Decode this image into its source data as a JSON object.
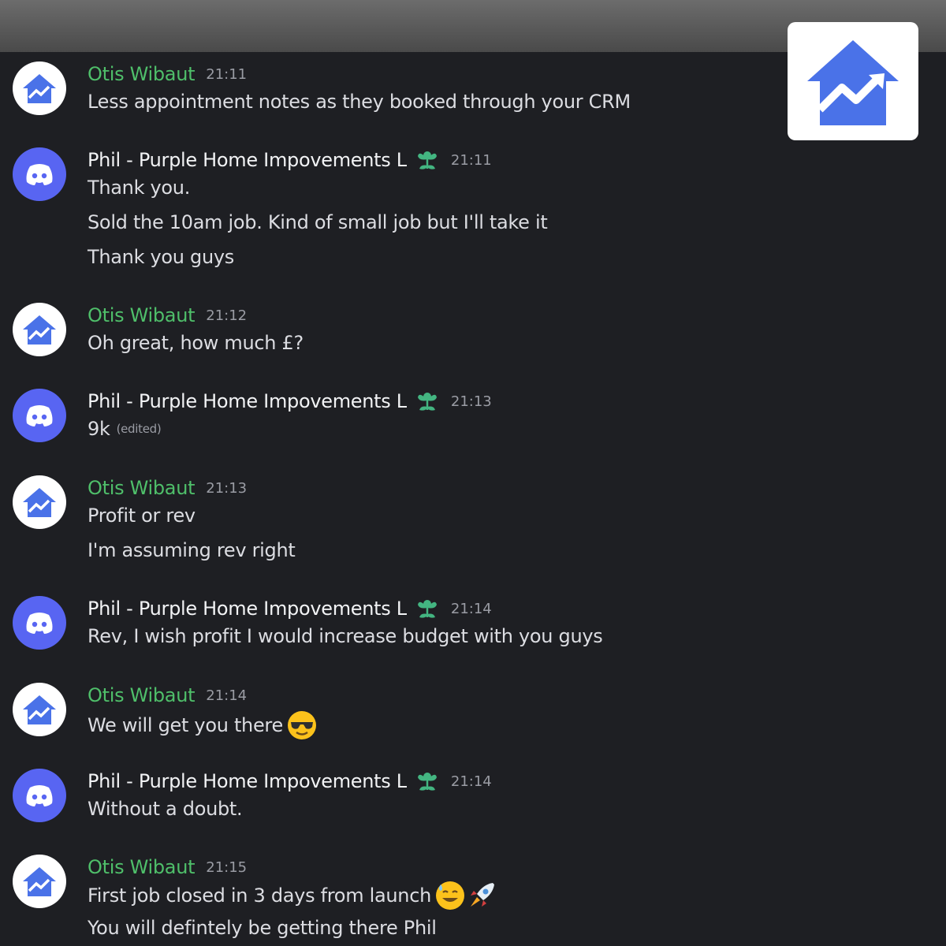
{
  "colors": {
    "background": "#1e1f23",
    "otis_name": "#4fbf6a",
    "discord_blurple": "#5865f2",
    "badge_green": "#43b581"
  },
  "icons": {
    "otis_avatar": "house-trend-icon",
    "phil_avatar": "discord-icon",
    "badge": "green-flower-badge-icon",
    "logo": "house-trend-logo"
  },
  "messages": [
    {
      "author": "Otis Wibaut",
      "time": "21:11",
      "lines": [
        "Less appointment notes as they booked through your CRM"
      ]
    },
    {
      "author": "Phil - Purple Home Impovements L",
      "time": "21:11",
      "lines": [
        "Thank you.",
        "Sold the 10am job. Kind of small job but I'll take it",
        "Thank you guys"
      ]
    },
    {
      "author": "Otis Wibaut",
      "time": "21:12",
      "lines": [
        "Oh great, how much £?"
      ]
    },
    {
      "author": "Phil - Purple Home Impovements L",
      "time": "21:13",
      "lines": [
        "9k"
      ],
      "edited": "(edited)"
    },
    {
      "author": "Otis Wibaut",
      "time": "21:13",
      "lines": [
        "Profit or rev",
        "I'm assuming rev right"
      ]
    },
    {
      "author": "Phil - Purple Home Impovements L",
      "time": "21:14",
      "lines": [
        "Rev, I wish profit I would increase budget with you guys"
      ]
    },
    {
      "author": "Otis Wibaut",
      "time": "21:14",
      "lines": [
        "We will get you there"
      ],
      "emoji": "sunglasses-emoji"
    },
    {
      "author": "Phil - Purple Home Impovements L",
      "time": "21:14",
      "lines": [
        "Without a doubt."
      ]
    },
    {
      "author": "Otis Wibaut",
      "time": "21:15",
      "lines": [
        "First job closed in 3 days from launch",
        "You will defintely be getting there Phil"
      ],
      "emoji": "sweat-smile-rocket-emoji"
    }
  ]
}
